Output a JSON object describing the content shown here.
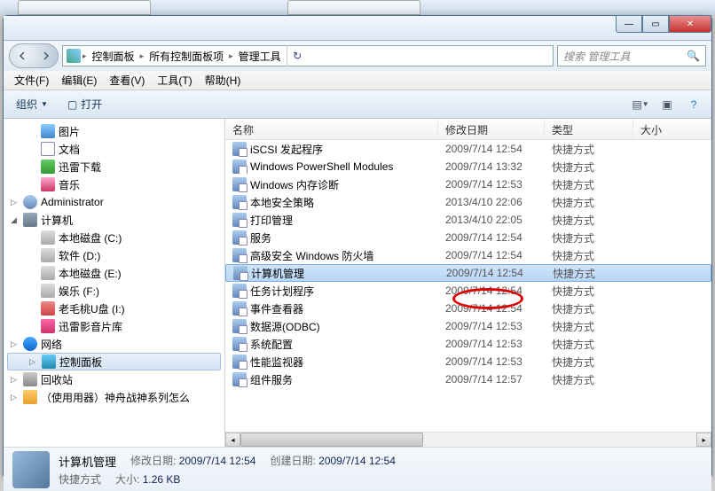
{
  "breadcrumb": [
    "控制面板",
    "所有控制面板项",
    "管理工具"
  ],
  "search_placeholder": "搜索 管理工具",
  "menubar": [
    {
      "label": "文件(F)"
    },
    {
      "label": "编辑(E)"
    },
    {
      "label": "查看(V)"
    },
    {
      "label": "工具(T)"
    },
    {
      "label": "帮助(H)"
    }
  ],
  "toolbar": {
    "organize": "组织",
    "open": "打开"
  },
  "sidebar": [
    {
      "level": 1,
      "icon": "pic",
      "label": "图片"
    },
    {
      "level": 1,
      "icon": "doc",
      "label": "文档"
    },
    {
      "level": 1,
      "icon": "dl",
      "label": "迅雷下载"
    },
    {
      "level": 1,
      "icon": "music",
      "label": "音乐"
    },
    {
      "level": 0,
      "icon": "user",
      "label": "Administrator",
      "exp": "▷"
    },
    {
      "level": 0,
      "icon": "computer",
      "label": "计算机",
      "exp": "◢"
    },
    {
      "level": 1,
      "icon": "disk",
      "label": "本地磁盘 (C:)"
    },
    {
      "level": 1,
      "icon": "disk",
      "label": "软件 (D:)"
    },
    {
      "level": 1,
      "icon": "disk",
      "label": "本地磁盘 (E:)"
    },
    {
      "level": 1,
      "icon": "disk",
      "label": "娱乐 (F:)"
    },
    {
      "level": 1,
      "icon": "usb",
      "label": "老毛桃U盘 (I:)"
    },
    {
      "level": 1,
      "icon": "media",
      "label": "迅雷影音片库"
    },
    {
      "level": 0,
      "icon": "net",
      "label": "网络",
      "exp": "▷"
    },
    {
      "level": 0,
      "icon": "cp",
      "label": "控制面板",
      "exp": "▷",
      "sel": true
    },
    {
      "level": 0,
      "icon": "trash",
      "label": "回收站",
      "exp": "▷"
    },
    {
      "level": 0,
      "icon": "folder",
      "label": "（使用用器）神舟战神系列怎么",
      "exp": "▷"
    }
  ],
  "columns": {
    "name": "名称",
    "date": "修改日期",
    "type": "类型",
    "size": "大小"
  },
  "files": [
    {
      "name": "iSCSI 发起程序",
      "date": "2009/7/14 12:54",
      "type": "快捷方式"
    },
    {
      "name": "Windows PowerShell Modules",
      "date": "2009/7/14 13:32",
      "type": "快捷方式"
    },
    {
      "name": "Windows 内存诊断",
      "date": "2009/7/14 12:53",
      "type": "快捷方式"
    },
    {
      "name": "本地安全策略",
      "date": "2013/4/10 22:06",
      "type": "快捷方式"
    },
    {
      "name": "打印管理",
      "date": "2013/4/10 22:05",
      "type": "快捷方式"
    },
    {
      "name": "服务",
      "date": "2009/7/14 12:54",
      "type": "快捷方式"
    },
    {
      "name": "高级安全 Windows 防火墙",
      "date": "2009/7/14 12:54",
      "type": "快捷方式"
    },
    {
      "name": "计算机管理",
      "date": "2009/7/14 12:54",
      "type": "快捷方式",
      "sel": true
    },
    {
      "name": "任务计划程序",
      "date": "2009/7/14 12:54",
      "type": "快捷方式"
    },
    {
      "name": "事件查看器",
      "date": "2009/7/14 12:54",
      "type": "快捷方式"
    },
    {
      "name": "数据源(ODBC)",
      "date": "2009/7/14 12:53",
      "type": "快捷方式"
    },
    {
      "name": "系统配置",
      "date": "2009/7/14 12:53",
      "type": "快捷方式"
    },
    {
      "name": "性能监视器",
      "date": "2009/7/14 12:53",
      "type": "快捷方式"
    },
    {
      "name": "组件服务",
      "date": "2009/7/14 12:57",
      "type": "快捷方式"
    }
  ],
  "details": {
    "name": "计算机管理",
    "mod_label": "修改日期:",
    "mod_val": "2009/7/14 12:54",
    "create_label": "创建日期:",
    "create_val": "2009/7/14 12:54",
    "type_label": "快捷方式",
    "size_label": "大小:",
    "size_val": "1.26 KB"
  }
}
